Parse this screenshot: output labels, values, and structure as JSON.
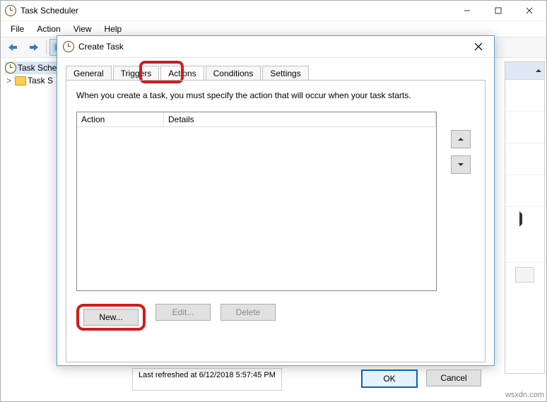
{
  "main_window": {
    "title": "Task Scheduler",
    "menu": {
      "file": "File",
      "action": "Action",
      "view": "View",
      "help": "Help"
    },
    "tree": {
      "library": "Task Scheduler (Local)",
      "library_short": "Task Sche",
      "sub": "Task Scheduler Library",
      "sub_short": "Task S",
      "expand": ">"
    },
    "status": "Last refreshed at 6/12/2018 5:57:45 PM"
  },
  "dialog": {
    "title": "Create Task",
    "tabs": {
      "general": "General",
      "triggers": "Triggers",
      "actions": "Actions",
      "conditions": "Conditions",
      "settings": "Settings"
    },
    "description": "When you create a task, you must specify the action that will occur when your task starts.",
    "columns": {
      "action": "Action",
      "details": "Details"
    },
    "buttons": {
      "new": "New...",
      "edit": "Edit...",
      "delete": "Delete",
      "ok": "OK",
      "cancel": "Cancel"
    }
  },
  "watermark": "wsxdn.com"
}
